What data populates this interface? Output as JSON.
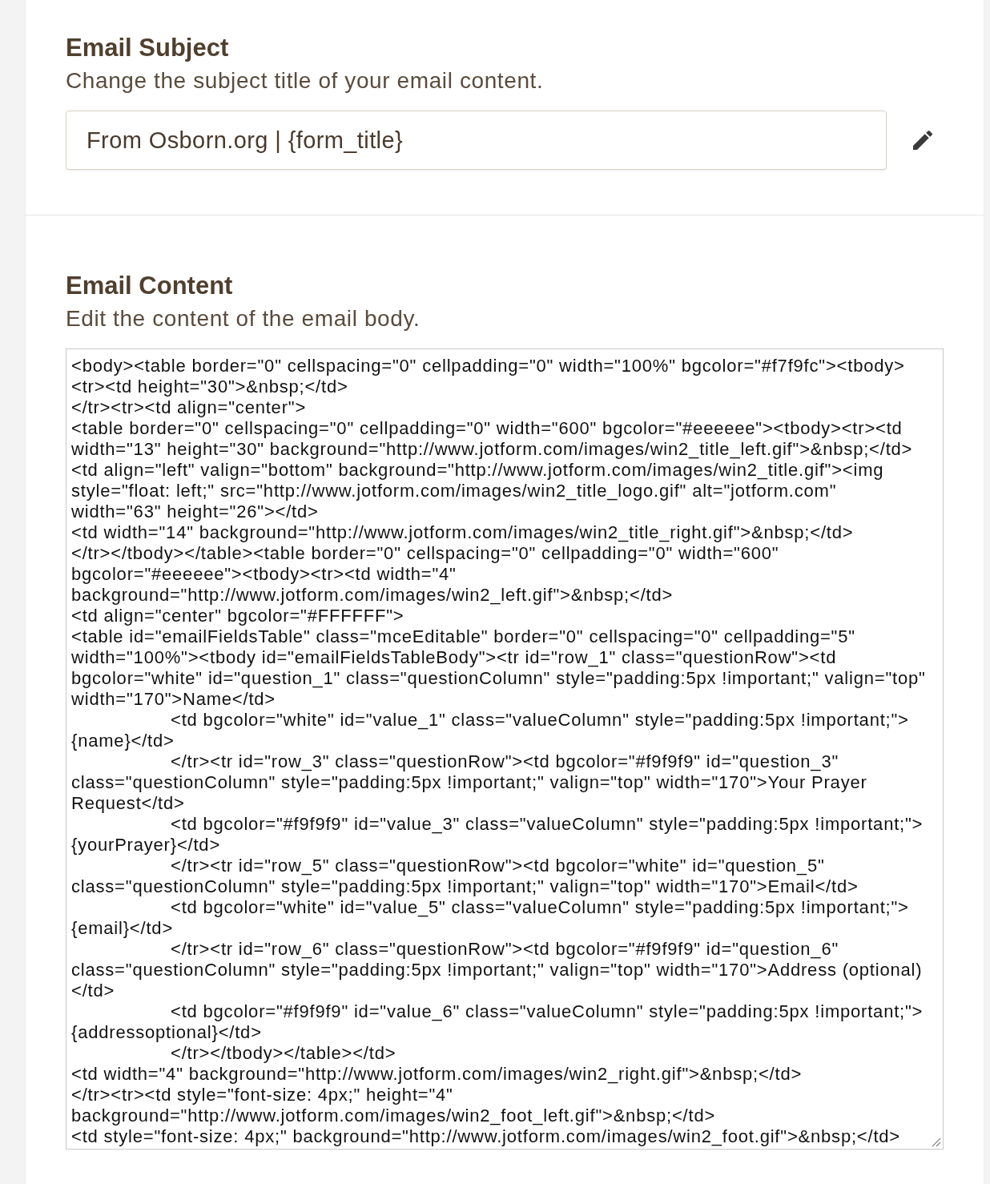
{
  "sections": [
    {
      "title": "Email Subject",
      "description": "Change the subject title of your email content.",
      "kind": "input",
      "value": "From Osborn.org | {form_title}"
    },
    {
      "title": "Email Content",
      "description": "Edit the content of the email body.",
      "kind": "code",
      "lines": [
        {
          "text": "<body><table border=\"0\" cellspacing=\"0\" cellpadding=\"0\" width=\"100%\" bgcolor=\"#f7f9fc\"><tbody>",
          "indent": false
        },
        {
          "text": "<tr><td height=\"30\">&nbsp;</td>",
          "indent": false
        },
        {
          "text": "</tr><tr><td align=\"center\">",
          "indent": false
        },
        {
          "text": "<table border=\"0\" cellspacing=\"0\" cellpadding=\"0\" width=\"600\" bgcolor=\"#eeeeee\"><tbody><tr><td",
          "indent": false
        },
        {
          "text": "width=\"13\" height=\"30\" background=\"http://www.jotform.com/images/win2_title_left.gif\">&nbsp;</td>",
          "indent": false
        },
        {
          "text": "<td align=\"left\" valign=\"bottom\" background=\"http://www.jotform.com/images/win2_title.gif\"><img",
          "indent": false
        },
        {
          "text": "style=\"float: left;\" src=\"http://www.jotform.com/images/win2_title_logo.gif\" alt=\"jotform.com\"",
          "indent": false
        },
        {
          "text": "width=\"63\" height=\"26\"></td>",
          "indent": false
        },
        {
          "text": "<td width=\"14\" background=\"http://www.jotform.com/images/win2_title_right.gif\">&nbsp;</td>",
          "indent": false
        },
        {
          "text": "</tr></tbody></table><table border=\"0\" cellspacing=\"0\" cellpadding=\"0\" width=\"600\"",
          "indent": false
        },
        {
          "text": "bgcolor=\"#eeeeee\"><tbody><tr><td width=\"4\"",
          "indent": false
        },
        {
          "text": "background=\"http://www.jotform.com/images/win2_left.gif\">&nbsp;</td>",
          "indent": false
        },
        {
          "text": "<td align=\"center\" bgcolor=\"#FFFFFF\">",
          "indent": false
        },
        {
          "text": "<table id=\"emailFieldsTable\" class=\"mceEditable\" border=\"0\" cellspacing=\"0\" cellpadding=\"5\"",
          "indent": false
        },
        {
          "text": "width=\"100%\"><tbody id=\"emailFieldsTableBody\"><tr id=\"row_1\" class=\"questionRow\"><td",
          "indent": false
        },
        {
          "text": "bgcolor=\"white\" id=\"question_1\" class=\"questionColumn\" style=\"padding:5px !important;\" valign=\"top\"",
          "indent": false
        },
        {
          "text": "width=\"170\">Name</td>",
          "indent": false
        },
        {
          "text": "<td bgcolor=\"white\" id=\"value_1\" class=\"valueColumn\" style=\"padding:5px !important;\">",
          "indent": true
        },
        {
          "text": "{name}</td>",
          "indent": false
        },
        {
          "text": "</tr><tr id=\"row_3\" class=\"questionRow\"><td bgcolor=\"#f9f9f9\" id=\"question_3\"",
          "indent": true
        },
        {
          "text": "class=\"questionColumn\" style=\"padding:5px !important;\" valign=\"top\" width=\"170\">Your Prayer",
          "indent": false
        },
        {
          "text": "Request</td>",
          "indent": false
        },
        {
          "text": "<td bgcolor=\"#f9f9f9\" id=\"value_3\" class=\"valueColumn\" style=\"padding:5px !important;\">",
          "indent": true
        },
        {
          "text": "{yourPrayer}</td>",
          "indent": false
        },
        {
          "text": "</tr><tr id=\"row_5\" class=\"questionRow\"><td bgcolor=\"white\" id=\"question_5\"",
          "indent": true
        },
        {
          "text": "class=\"questionColumn\" style=\"padding:5px !important;\" valign=\"top\" width=\"170\">Email</td>",
          "indent": false
        },
        {
          "text": "<td bgcolor=\"white\" id=\"value_5\" class=\"valueColumn\" style=\"padding:5px !important;\">",
          "indent": true
        },
        {
          "text": "{email}</td>",
          "indent": false
        },
        {
          "text": "</tr><tr id=\"row_6\" class=\"questionRow\"><td bgcolor=\"#f9f9f9\" id=\"question_6\"",
          "indent": true
        },
        {
          "text": "class=\"questionColumn\" style=\"padding:5px !important;\" valign=\"top\" width=\"170\">Address (optional)",
          "indent": false
        },
        {
          "text": "</td>",
          "indent": false
        },
        {
          "text": "<td bgcolor=\"#f9f9f9\" id=\"value_6\" class=\"valueColumn\" style=\"padding:5px !important;\">",
          "indent": true
        },
        {
          "text": "{addressoptional}</td>",
          "indent": false
        },
        {
          "text": "</tr></tbody></table></td>",
          "indent": true
        },
        {
          "text": "<td width=\"4\" background=\"http://www.jotform.com/images/win2_right.gif\">&nbsp;</td>",
          "indent": false
        },
        {
          "text": "</tr><tr><td style=\"font-size: 4px;\" height=\"4\"",
          "indent": false
        },
        {
          "text": "background=\"http://www.jotform.com/images/win2_foot_left.gif\">&nbsp;</td>",
          "indent": false
        },
        {
          "text": "<td style=\"font-size: 4px;\" background=\"http://www.jotform.com/images/win2_foot.gif\">&nbsp;</td>",
          "indent": false
        }
      ]
    }
  ]
}
